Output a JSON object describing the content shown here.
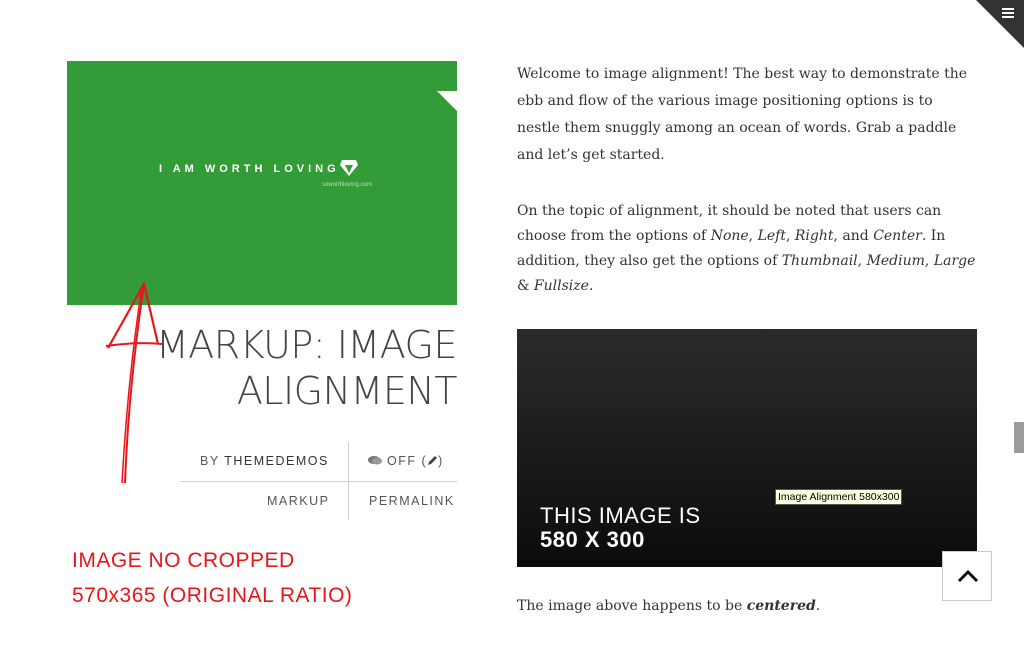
{
  "menu": {
    "icon": "menu-icon"
  },
  "featured": {
    "image_text": "I AM WORTH LOVING",
    "image_subtext": "soworthloving.com",
    "bg_color": "#339b37",
    "gem_icon": "diamond-icon"
  },
  "post": {
    "title_line1": "MARKUP: IMAGE",
    "title_line2": "ALIGNMENT",
    "by_label": "BY",
    "author": "THEMEDEMOS",
    "comments_label": "OFF",
    "comment_icon": "comment-icon",
    "edit_icon": "pencil-icon",
    "category": "MARKUP",
    "permalink": "PERMALINK"
  },
  "annotation": {
    "line1": "IMAGE NO CROPPED",
    "line2": "570x365 (ORIGINAL RATIO)",
    "color": "#e8161b"
  },
  "content": {
    "p1": "Welcome to image alignment! The best way to demonstrate the ebb and flow of the various image positioning options is to nestle them snuggly among an ocean of words. Grab a paddle and let’s get started.",
    "p2_a": "On the topic of alignment, it should be noted that users can choose from the options of ",
    "opt_none": "None",
    "sep1": ", ",
    "opt_left": "Left",
    "sep2": ", ",
    "opt_right": "Right",
    "sep3": ", and ",
    "opt_center": "Center",
    "p2_b": ". In addition, they also get the options of ",
    "opt_thumb": "Thumbnail",
    "sep4": ", ",
    "opt_medium": "Medium",
    "sep5": ", ",
    "opt_large": "Large",
    "sep6": " & ",
    "opt_full": "Fullsize",
    "p2_end": ".",
    "dark_image_line1": "THIS IMAGE IS",
    "dark_image_line2": "580 X 300",
    "tooltip": "Image Alignment 580x300",
    "caption_a": "The image above happens to be ",
    "caption_em": "centered",
    "caption_end": "."
  },
  "back_to_top": {
    "icon": "chevron-up-icon"
  }
}
